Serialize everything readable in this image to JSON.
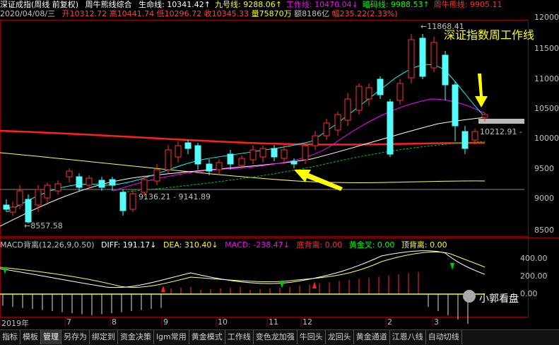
{
  "header": {
    "name": "深证成指(周线 前复权)",
    "indicator": "周牛熊线综合",
    "lines": [
      {
        "label": "生命线:",
        "value": "10341.42",
        "arrow": "↑",
        "color": "#ffffff"
      },
      {
        "label": "九号线:",
        "value": "9288.06",
        "arrow": "↑",
        "color": "#ffff00"
      },
      {
        "label": "工作线:",
        "value": "10470.04",
        "arrow": "↓",
        "color": "#ff00ff"
      },
      {
        "label": "暗码线:",
        "value": "9988.53",
        "arrow": "↑",
        "color": "#00ff00"
      },
      {
        "label": "周牛熊线:",
        "value": "9905.11",
        "arrow": "",
        "color": "#ff3030"
      }
    ],
    "date": "2020/04/08/三",
    "open": "开10312.72",
    "high": "高10441.74",
    "low": "低10296.72",
    "close": "收10345.33",
    "volume": "量75870万",
    "amount": "额8186亿",
    "change": "幅235.22(2.33%)"
  },
  "price_axis": [
    "12000",
    "11500",
    "11000",
    "10500",
    "10000",
    "9500",
    "9000",
    "8500"
  ],
  "annotations": {
    "high": "←11868.41",
    "low": "←8557.58",
    "range": "9136.21 - 9141.89",
    "current": "10212.91 -",
    "title": "深证指数周工作线"
  },
  "macd": {
    "name": "MACD背离(12,26,9,0.50)",
    "diff": "DIFF: 191.17↓",
    "dea": "DEA: 310.40↓",
    "macd": "MACD: -238.47↓",
    "bottom_div": "底背离: 0.00",
    "golden": "黄金叉: 0.00",
    "top_div": "顶背离: 0.00",
    "axis": [
      "400.00",
      "200.00",
      "0.00"
    ]
  },
  "dates": [
    "2019年",
    "7",
    "8",
    "9",
    "10",
    "11",
    "12",
    "2",
    "3"
  ],
  "watermark": "小郭看盘",
  "tabs": [
    "指标",
    "模板",
    "管理",
    "另存为",
    "绑定到",
    "资金决策",
    "lgm常用",
    "黄金模式",
    "工作线",
    "变色龙加强",
    "牛回头",
    "龙回头",
    "黄金通道",
    "江恩八线",
    "自动切线"
  ],
  "active_tab": "管理"
}
